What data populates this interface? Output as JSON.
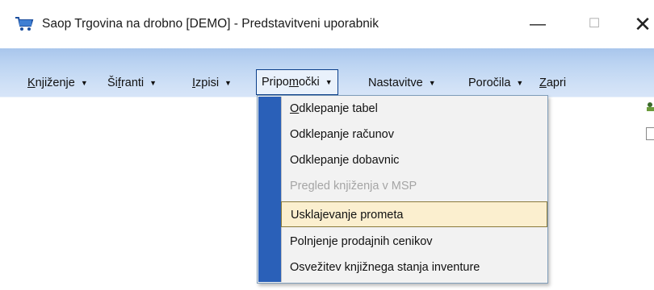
{
  "window": {
    "title": "Saop Trgovina na drobno [DEMO] - Predstavitveni uporabnik",
    "min_glyph": "—",
    "max_glyph": "☐",
    "close_glyph": "✕"
  },
  "menubar": {
    "items": [
      {
        "pre": "",
        "ul": "K",
        "post": "njiženje",
        "arrow": "▼"
      },
      {
        "pre": "Ši",
        "ul": "f",
        "post": "ranti",
        "arrow": "▼"
      },
      {
        "pre": "",
        "ul": "I",
        "post": "zpisi",
        "arrow": "▼"
      },
      {
        "pre": "Pripo",
        "ul": "m",
        "post": "očki",
        "arrow": "▼"
      },
      {
        "pre": "",
        "ul": "",
        "post": "Nastavitve",
        "arrow": "▼"
      },
      {
        "pre": "",
        "ul": "",
        "post": "Poročila",
        "arrow": "▼"
      },
      {
        "pre": "",
        "ul": "Z",
        "post": "apri",
        "arrow": ""
      }
    ]
  },
  "dropdown": {
    "items": [
      {
        "ul": "O",
        "post": "dklepanje tabel",
        "state": "enabled"
      },
      {
        "ul": "",
        "post": "Odklepanje računov",
        "state": "enabled"
      },
      {
        "ul": "",
        "post": "Odklepanje dobavnic",
        "state": "enabled"
      },
      {
        "ul": "",
        "post": "Pregled knjiženja v MSP",
        "state": "disabled"
      },
      {
        "ul": "",
        "post": "Usklajevanje prometa",
        "state": "highlighted"
      },
      {
        "ul": "",
        "post": "Polnjenje prodajnih cenikov",
        "state": "enabled"
      },
      {
        "ul": "",
        "post": "Osvežitev knjižnega stanja inventure",
        "state": "enabled"
      }
    ]
  },
  "colors": {
    "accent_strip": "#2a60b8",
    "highlight_bg": "#fbefcf",
    "menubar_gradient_top": "#a9c6ec"
  }
}
